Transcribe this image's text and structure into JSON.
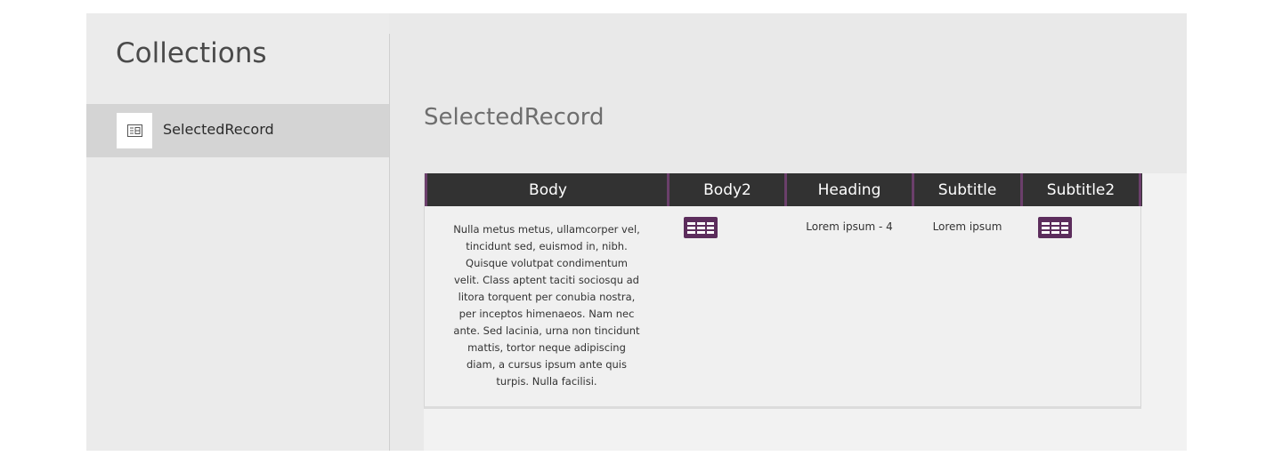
{
  "sidebar": {
    "title": "Collections",
    "items": [
      {
        "label": "SelectedRecord",
        "icon": "record-icon"
      }
    ]
  },
  "main": {
    "title": "SelectedRecord",
    "table": {
      "columns": [
        "Body",
        "Body2",
        "Heading",
        "Subtitle",
        "Subtitle2"
      ],
      "rows": [
        {
          "body_lines": [
            "Nulla metus metus, ullamcorper vel,",
            "tincidunt sed, euismod in, nibh.",
            "Quisque volutpat condimentum",
            "velit. Class aptent taciti sociosqu ad",
            "litora torquent per conubia nostra,",
            "per inceptos himenaeos. Nam nec",
            "ante. Sed lacinia, urna non tincidunt",
            "mattis, tortor neque adipiscing",
            "diam, a cursus ipsum ante quis",
            "turpis. Nulla facilisi."
          ],
          "body2": "table-icon",
          "heading": "Lorem ipsum - 4",
          "subtitle": "Lorem ipsum",
          "subtitle2": "table-icon"
        }
      ]
    }
  },
  "colors": {
    "header_bg": "#323232",
    "accent": "#6b3f6b",
    "selected_item_bg": "#d4d4d4",
    "icon_color": "#5c2d5c"
  }
}
